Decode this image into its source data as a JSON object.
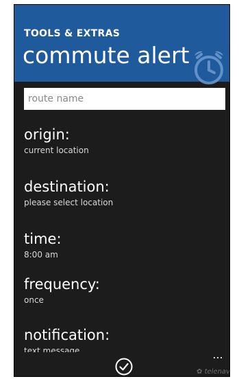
{
  "header": {
    "app_label": "TOOLS & EXTRAS",
    "page_title": "commute alert",
    "accent_color": "#1f5a9c",
    "icon": "alarm-clock-icon"
  },
  "route": {
    "placeholder": "route name",
    "value": ""
  },
  "fields": {
    "origin": {
      "label": "origin:",
      "value": "current location"
    },
    "destination": {
      "label": "destination:",
      "value": "please select location"
    },
    "time": {
      "label": "time:",
      "value": "8:00 am"
    },
    "frequency": {
      "label": "frequency:",
      "value": "once"
    },
    "notification": {
      "label": "notification:",
      "value": "text message"
    }
  },
  "appbar": {
    "save_icon": "checkmark-icon",
    "more_label": "...",
    "brand": "telenav"
  }
}
